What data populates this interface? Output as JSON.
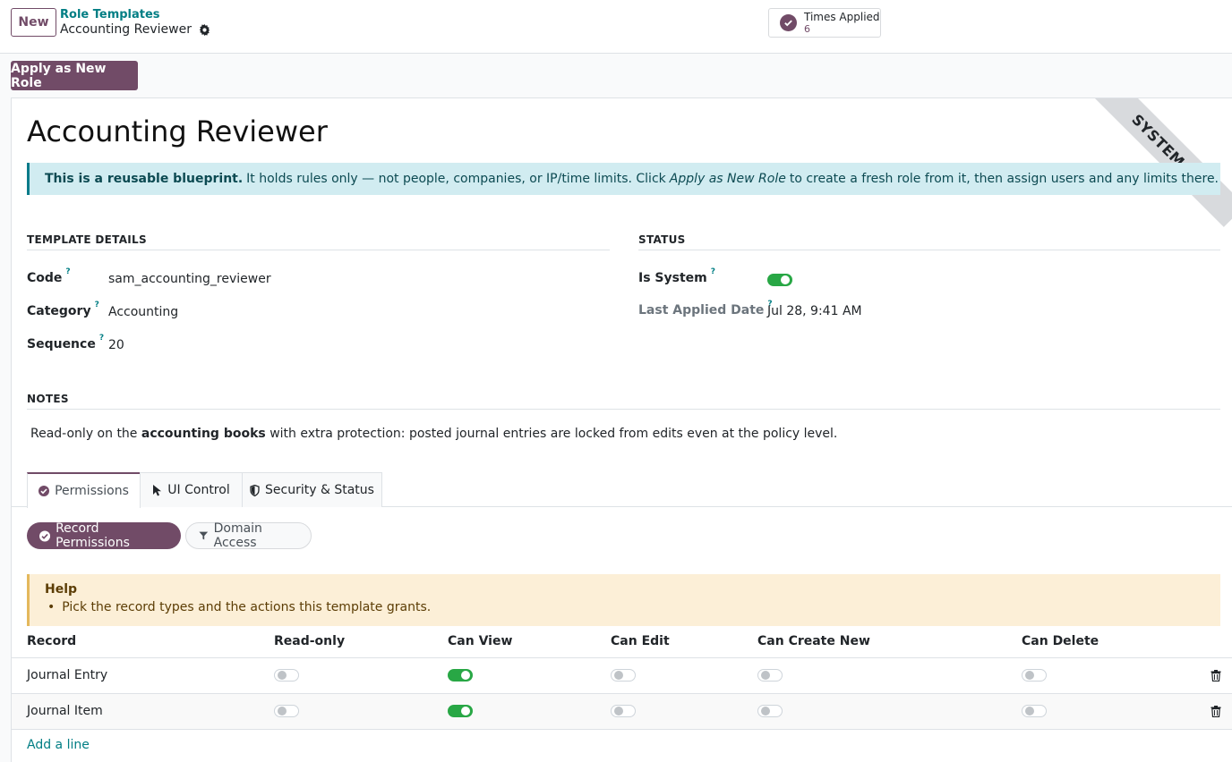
{
  "control_panel": {
    "new_label": "New",
    "breadcrumb_parent": "Role Templates",
    "breadcrumb_current": "Accounting Reviewer",
    "stat_button": {
      "label": "Times Applied",
      "value": "6"
    }
  },
  "actions": {
    "apply_label": "Apply as New Role"
  },
  "form": {
    "ribbon": "SYSTEM",
    "title": "Accounting Reviewer",
    "info": {
      "strong": "This is a reusable blueprint.",
      "text1": "It holds rules only — not people, companies, or IP/time limits. Click",
      "em": "Apply as New Role",
      "text2": "to create a fresh role from it, then assign users and any limits there."
    },
    "template_details": {
      "heading": "TEMPLATE DETAILS",
      "code_label": "Code",
      "code_value": "sam_accounting_reviewer",
      "category_label": "Category",
      "category_value": "Accounting",
      "sequence_label": "Sequence",
      "sequence_value": "20",
      "help_mark": "?"
    },
    "status": {
      "heading": "STATUS",
      "is_system_label": "Is System",
      "is_system": true,
      "last_applied_label": "Last Applied Date",
      "last_applied_value": "Jul 28, 9:41 AM"
    },
    "notes": {
      "heading": "NOTES",
      "text1": "Read-only on the",
      "strong": "accounting books",
      "text2": "with extra protection: posted journal entries are locked from edits even at the policy level."
    },
    "tabs": [
      "Permissions",
      "UI Control",
      "Security & Status"
    ],
    "sub_tabs": [
      "Record Permissions",
      "Domain Access"
    ],
    "help": {
      "title": "Help",
      "item": "Pick the record types and the actions this template grants."
    },
    "table": {
      "columns": [
        "Record",
        "Read-only",
        "Can View",
        "Can Edit",
        "Can Create New",
        "Can Delete"
      ],
      "rows": [
        {
          "record": "Journal Entry",
          "read_only": false,
          "can_view": true,
          "can_edit": false,
          "can_create": false,
          "can_delete": false
        },
        {
          "record": "Journal Item",
          "read_only": false,
          "can_view": true,
          "can_edit": false,
          "can_create": false,
          "can_delete": false
        }
      ],
      "add_line": "Add a line"
    },
    "colors": {
      "brand": "#714b67",
      "link": "#017e84",
      "toggle_on": "#28a745"
    }
  }
}
